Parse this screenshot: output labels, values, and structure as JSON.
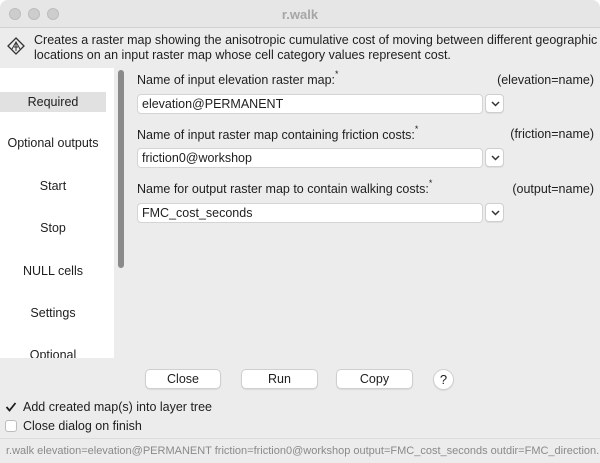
{
  "window": {
    "title": "r.walk"
  },
  "description": {
    "line1": "Creates a raster map showing the anisotropic cumulative cost of moving between different geographic",
    "line2": "locations on an input raster map whose cell category values represent cost."
  },
  "sidebar": {
    "items": [
      {
        "label": "Required",
        "active": true
      },
      {
        "label": "Optional outputs"
      },
      {
        "label": "Start"
      },
      {
        "label": "Stop"
      },
      {
        "label": "NULL cells"
      },
      {
        "label": "Settings"
      },
      {
        "label": "Optional"
      }
    ]
  },
  "fields": [
    {
      "label": "Name of input elevation raster map:",
      "required_mark": "*",
      "key": "(elevation=name)",
      "value": "elevation@PERMANENT"
    },
    {
      "label": "Name of input raster map containing friction costs:",
      "required_mark": "*",
      "key": "(friction=name)",
      "value": "friction0@workshop"
    },
    {
      "label": "Name for output raster map to contain walking costs:",
      "required_mark": "*",
      "key": "(output=name)",
      "value": "FMC_cost_seconds"
    }
  ],
  "buttons": {
    "close": "Close",
    "run": "Run",
    "copy": "Copy",
    "help": "?"
  },
  "options": [
    {
      "label": "Add created map(s) into layer tree",
      "checked": true
    },
    {
      "label": "Close dialog on finish",
      "checked": false
    }
  ],
  "command": "r.walk elevation=elevation@PERMANENT friction=friction0@workshop output=FMC_cost_seconds outdir=FMC_direction..."
}
